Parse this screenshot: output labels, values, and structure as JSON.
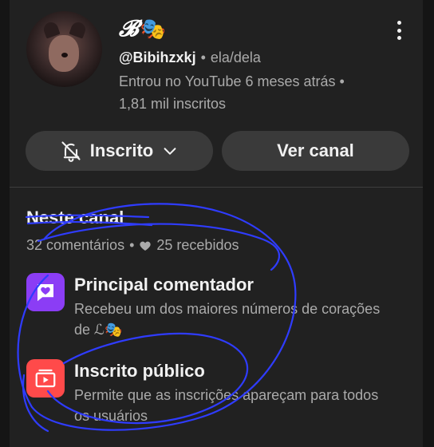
{
  "channel": {
    "display_name_script": "𝓑",
    "display_name_emoji": "🎭",
    "handle": "@Bibihzxkj",
    "separator": "•",
    "pronouns": "ela/dela",
    "joined": "Entrou no YouTube 6 meses atrás •",
    "subscribers": "1,81 mil inscritos"
  },
  "buttons": {
    "subscribed_label": "Inscrito",
    "view_channel_label": "Ver canal"
  },
  "section": {
    "title": "Neste canal",
    "comments": "32 comentários",
    "separator": "•",
    "hearts": "25 recebidos"
  },
  "badges": [
    {
      "title": "Principal comentador",
      "desc_line1": "Recebeu um dos maiores números de corações",
      "desc_line2": "de ℒ🎭",
      "icon": "heart-comment-icon",
      "color": "#8b3df5"
    },
    {
      "title": "Inscrito público",
      "desc_line1": "Permite que as inscrições apareçam para todos",
      "desc_line2": "os usuários",
      "icon": "subscriptions-icon",
      "color": "#ff4a4a"
    }
  ],
  "annotation": {
    "stroke_color": "#2f3cff"
  }
}
